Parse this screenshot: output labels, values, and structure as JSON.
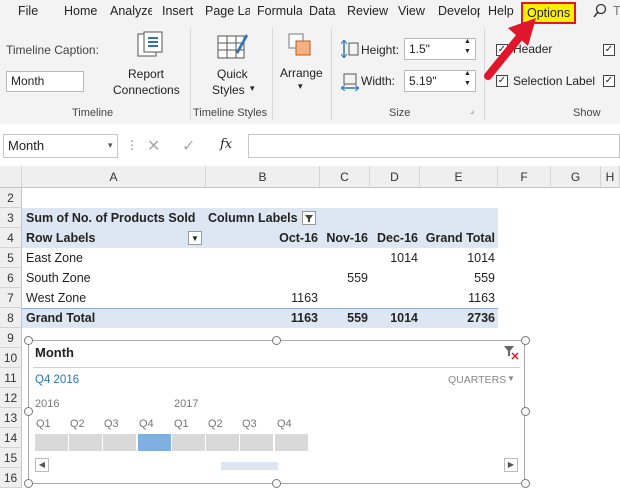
{
  "ribbon_tabs": [
    "File",
    "Home",
    "Analyze",
    "Insert",
    "Page Layout",
    "Formulas",
    "Data",
    "Review",
    "View",
    "Developer",
    "Help",
    "Options"
  ],
  "ribbon": {
    "timeline_caption_label": "Timeline Caption:",
    "timeline_caption_value": "Month",
    "report_connections_line1": "Report",
    "report_connections_line2": "Connections",
    "timeline_group": "Timeline",
    "quick_styles_line1": "Quick",
    "quick_styles_line2": "Styles",
    "timeline_styles_group": "Timeline Styles",
    "arrange_label": "Arrange",
    "height_label": "Height:",
    "height_value": "1.5\"",
    "width_label": "Width:",
    "width_value": "5.19\"",
    "size_group": "Size",
    "header_label": "Header",
    "selection_label": "Selection Label",
    "show_group": "Show"
  },
  "formula_bar": {
    "name_box": "Month",
    "fx": "fx"
  },
  "columns": [
    "A",
    "B",
    "C",
    "D",
    "E",
    "F",
    "G",
    "H"
  ],
  "rows": [
    "2",
    "3",
    "4",
    "5",
    "6",
    "7",
    "8",
    "9",
    "10",
    "11",
    "12",
    "13",
    "14",
    "15",
    "16"
  ],
  "pivot": {
    "title": "Sum of No. of Products Sold",
    "column_labels": "Column Labels",
    "row_labels": "Row Labels",
    "headers": [
      "Oct-16",
      "Nov-16",
      "Dec-16",
      "Grand Total"
    ],
    "rows": [
      {
        "label": "East Zone",
        "oct": "",
        "nov": "",
        "dec": "1014",
        "total": "1014"
      },
      {
        "label": "South Zone",
        "oct": "",
        "nov": "559",
        "dec": "",
        "total": "559"
      },
      {
        "label": "West Zone",
        "oct": "1163",
        "nov": "",
        "dec": "",
        "total": "1163"
      }
    ],
    "grand_total": {
      "label": "Grand Total",
      "oct": "1163",
      "nov": "559",
      "dec": "1014",
      "total": "2736"
    }
  },
  "timeline": {
    "caption": "Month",
    "selection": "Q4 2016",
    "level": "QUARTERS",
    "year1": "2016",
    "year2": "2017",
    "quarters": [
      "Q1",
      "Q2",
      "Q3",
      "Q4",
      "Q1",
      "Q2",
      "Q3",
      "Q4"
    ],
    "selected_index": 3
  },
  "colors": {
    "pivot_header": "#dde6f3",
    "pivot_total_border": "#8eaadb",
    "selected": "#7fb0e0",
    "accent": "#2f75b5",
    "highlight": "#ffef00",
    "arrow": "#e0162b"
  }
}
